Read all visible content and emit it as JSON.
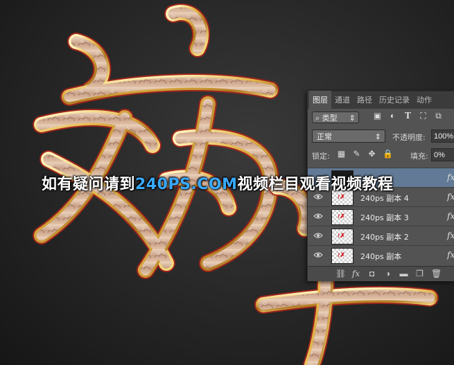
{
  "watermark": {
    "prefix": "如有疑问请到",
    "site": "240PS.COM",
    "suffix": "视频栏目观看视频教程"
  },
  "artwork": {
    "description_colors": {
      "gold": "#e8c66a",
      "body": "#d9b9a0",
      "red_edge": "#c0281e"
    }
  },
  "panel": {
    "tabs": [
      "图层",
      "通道",
      "路径",
      "历史记录",
      "动作"
    ],
    "filter": {
      "label": "类型",
      "icons": [
        "image-filter-icon",
        "adjustment-filter-icon",
        "type-filter-icon",
        "shape-filter-icon",
        "smart-object-filter-icon"
      ]
    },
    "blend_mode": "正常",
    "opacity_label": "不透明度:",
    "opacity_value": "100%",
    "lock_label": "锁定:",
    "fill_label": "填充:",
    "fill_value": "0%",
    "layers": [
      {
        "name": "",
        "selected": true
      },
      {
        "name": "240ps 副本 4",
        "selected": false
      },
      {
        "name": "240ps 副本  3",
        "selected": false
      },
      {
        "name": "240ps 副本 2",
        "selected": false
      },
      {
        "name": "240ps 副本",
        "selected": false
      }
    ],
    "fx_label": "fx"
  }
}
